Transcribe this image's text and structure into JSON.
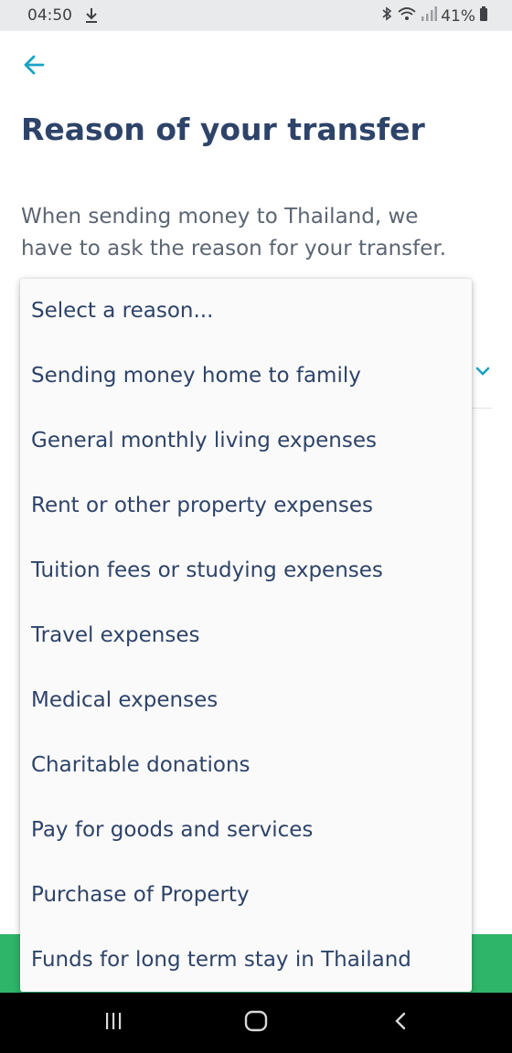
{
  "status_bar": {
    "time": "04:50",
    "battery": "41%",
    "icons": [
      "download-icon",
      "bluetooth-icon",
      "wifi-icon",
      "signal-icon",
      "battery-icon"
    ]
  },
  "header": {
    "back_icon": "arrow-left-icon",
    "title": "Reason of your transfer"
  },
  "description": {
    "line1": "When sending money to Thailand, we",
    "line2": "have to ask the reason for your transfer."
  },
  "dropdown": {
    "options": [
      "Select a reason...",
      "Sending money home to family",
      "General monthly living expenses",
      "Rent or other property expenses",
      "Tuition fees or studying expenses",
      "Travel expenses",
      "Medical expenses",
      "Charitable donations",
      "Pay for goods and services",
      "Purchase of Property",
      "Funds for long term stay in Thailand"
    ]
  },
  "colors": {
    "accent": "#1aa2c4",
    "title": "#2e4369",
    "body_text": "#5c6572",
    "button": "#2fb56a",
    "status_bar": "#e9eaec"
  },
  "nav_bar": {
    "icons": [
      "recent-apps-icon",
      "home-icon",
      "back-nav-icon"
    ]
  }
}
